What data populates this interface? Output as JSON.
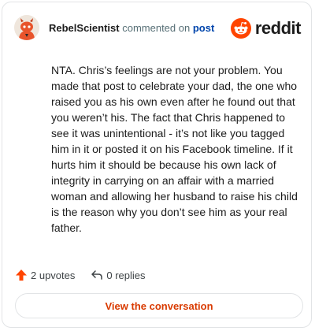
{
  "header": {
    "username": "RebelScientist",
    "action": "commented on",
    "link": "post"
  },
  "logo": {
    "text": "reddit",
    "brand_color": "#ff4500"
  },
  "comment": {
    "text": "NTA. Chris’s feelings are not your problem. You made that post to celebrate your dad, the one who raised you as his own even after he found out that you weren’t his. The fact that Chris happened to see it was unintentional - it’s not like you tagged him in it or posted it on his Facebook timeline. If it hurts him it should be because his own lack of integrity in carrying on an affair with a married woman and allowing her husband to raise his child is the reason why you don’t see him as your real father."
  },
  "footer": {
    "upvotes_label": "2 upvotes",
    "replies_label": "0 replies",
    "upvote_icon": "upvote-arrow-icon",
    "reply_icon": "reply-arrow-icon",
    "upvote_color": "#ff4500"
  },
  "cta": {
    "label": "View the conversation",
    "color": "#d93a00"
  }
}
